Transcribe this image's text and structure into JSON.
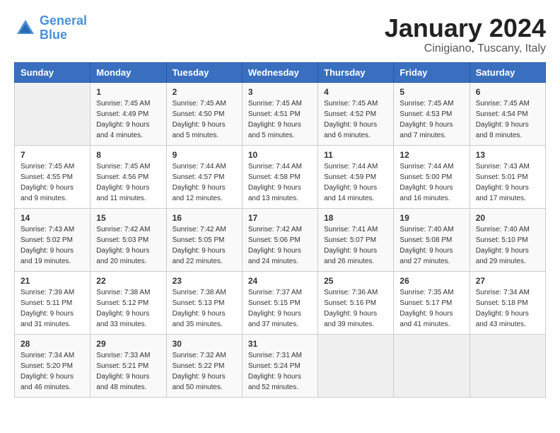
{
  "header": {
    "logo_line1": "General",
    "logo_line2": "Blue",
    "month": "January 2024",
    "location": "Cinigiano, Tuscany, Italy"
  },
  "days_of_week": [
    "Sunday",
    "Monday",
    "Tuesday",
    "Wednesday",
    "Thursday",
    "Friday",
    "Saturday"
  ],
  "weeks": [
    [
      {
        "day": "",
        "sunrise": "",
        "sunset": "",
        "daylight": ""
      },
      {
        "day": "1",
        "sunrise": "Sunrise: 7:45 AM",
        "sunset": "Sunset: 4:49 PM",
        "daylight": "Daylight: 9 hours and 4 minutes."
      },
      {
        "day": "2",
        "sunrise": "Sunrise: 7:45 AM",
        "sunset": "Sunset: 4:50 PM",
        "daylight": "Daylight: 9 hours and 5 minutes."
      },
      {
        "day": "3",
        "sunrise": "Sunrise: 7:45 AM",
        "sunset": "Sunset: 4:51 PM",
        "daylight": "Daylight: 9 hours and 5 minutes."
      },
      {
        "day": "4",
        "sunrise": "Sunrise: 7:45 AM",
        "sunset": "Sunset: 4:52 PM",
        "daylight": "Daylight: 9 hours and 6 minutes."
      },
      {
        "day": "5",
        "sunrise": "Sunrise: 7:45 AM",
        "sunset": "Sunset: 4:53 PM",
        "daylight": "Daylight: 9 hours and 7 minutes."
      },
      {
        "day": "6",
        "sunrise": "Sunrise: 7:45 AM",
        "sunset": "Sunset: 4:54 PM",
        "daylight": "Daylight: 9 hours and 8 minutes."
      }
    ],
    [
      {
        "day": "7",
        "sunrise": "Sunrise: 7:45 AM",
        "sunset": "Sunset: 4:55 PM",
        "daylight": "Daylight: 9 hours and 9 minutes."
      },
      {
        "day": "8",
        "sunrise": "Sunrise: 7:45 AM",
        "sunset": "Sunset: 4:56 PM",
        "daylight": "Daylight: 9 hours and 11 minutes."
      },
      {
        "day": "9",
        "sunrise": "Sunrise: 7:44 AM",
        "sunset": "Sunset: 4:57 PM",
        "daylight": "Daylight: 9 hours and 12 minutes."
      },
      {
        "day": "10",
        "sunrise": "Sunrise: 7:44 AM",
        "sunset": "Sunset: 4:58 PM",
        "daylight": "Daylight: 9 hours and 13 minutes."
      },
      {
        "day": "11",
        "sunrise": "Sunrise: 7:44 AM",
        "sunset": "Sunset: 4:59 PM",
        "daylight": "Daylight: 9 hours and 14 minutes."
      },
      {
        "day": "12",
        "sunrise": "Sunrise: 7:44 AM",
        "sunset": "Sunset: 5:00 PM",
        "daylight": "Daylight: 9 hours and 16 minutes."
      },
      {
        "day": "13",
        "sunrise": "Sunrise: 7:43 AM",
        "sunset": "Sunset: 5:01 PM",
        "daylight": "Daylight: 9 hours and 17 minutes."
      }
    ],
    [
      {
        "day": "14",
        "sunrise": "Sunrise: 7:43 AM",
        "sunset": "Sunset: 5:02 PM",
        "daylight": "Daylight: 9 hours and 19 minutes."
      },
      {
        "day": "15",
        "sunrise": "Sunrise: 7:42 AM",
        "sunset": "Sunset: 5:03 PM",
        "daylight": "Daylight: 9 hours and 20 minutes."
      },
      {
        "day": "16",
        "sunrise": "Sunrise: 7:42 AM",
        "sunset": "Sunset: 5:05 PM",
        "daylight": "Daylight: 9 hours and 22 minutes."
      },
      {
        "day": "17",
        "sunrise": "Sunrise: 7:42 AM",
        "sunset": "Sunset: 5:06 PM",
        "daylight": "Daylight: 9 hours and 24 minutes."
      },
      {
        "day": "18",
        "sunrise": "Sunrise: 7:41 AM",
        "sunset": "Sunset: 5:07 PM",
        "daylight": "Daylight: 9 hours and 26 minutes."
      },
      {
        "day": "19",
        "sunrise": "Sunrise: 7:40 AM",
        "sunset": "Sunset: 5:08 PM",
        "daylight": "Daylight: 9 hours and 27 minutes."
      },
      {
        "day": "20",
        "sunrise": "Sunrise: 7:40 AM",
        "sunset": "Sunset: 5:10 PM",
        "daylight": "Daylight: 9 hours and 29 minutes."
      }
    ],
    [
      {
        "day": "21",
        "sunrise": "Sunrise: 7:39 AM",
        "sunset": "Sunset: 5:11 PM",
        "daylight": "Daylight: 9 hours and 31 minutes."
      },
      {
        "day": "22",
        "sunrise": "Sunrise: 7:38 AM",
        "sunset": "Sunset: 5:12 PM",
        "daylight": "Daylight: 9 hours and 33 minutes."
      },
      {
        "day": "23",
        "sunrise": "Sunrise: 7:38 AM",
        "sunset": "Sunset: 5:13 PM",
        "daylight": "Daylight: 9 hours and 35 minutes."
      },
      {
        "day": "24",
        "sunrise": "Sunrise: 7:37 AM",
        "sunset": "Sunset: 5:15 PM",
        "daylight": "Daylight: 9 hours and 37 minutes."
      },
      {
        "day": "25",
        "sunrise": "Sunrise: 7:36 AM",
        "sunset": "Sunset: 5:16 PM",
        "daylight": "Daylight: 9 hours and 39 minutes."
      },
      {
        "day": "26",
        "sunrise": "Sunrise: 7:35 AM",
        "sunset": "Sunset: 5:17 PM",
        "daylight": "Daylight: 9 hours and 41 minutes."
      },
      {
        "day": "27",
        "sunrise": "Sunrise: 7:34 AM",
        "sunset": "Sunset: 5:18 PM",
        "daylight": "Daylight: 9 hours and 43 minutes."
      }
    ],
    [
      {
        "day": "28",
        "sunrise": "Sunrise: 7:34 AM",
        "sunset": "Sunset: 5:20 PM",
        "daylight": "Daylight: 9 hours and 46 minutes."
      },
      {
        "day": "29",
        "sunrise": "Sunrise: 7:33 AM",
        "sunset": "Sunset: 5:21 PM",
        "daylight": "Daylight: 9 hours and 48 minutes."
      },
      {
        "day": "30",
        "sunrise": "Sunrise: 7:32 AM",
        "sunset": "Sunset: 5:22 PM",
        "daylight": "Daylight: 9 hours and 50 minutes."
      },
      {
        "day": "31",
        "sunrise": "Sunrise: 7:31 AM",
        "sunset": "Sunset: 5:24 PM",
        "daylight": "Daylight: 9 hours and 52 minutes."
      },
      {
        "day": "",
        "sunrise": "",
        "sunset": "",
        "daylight": ""
      },
      {
        "day": "",
        "sunrise": "",
        "sunset": "",
        "daylight": ""
      },
      {
        "day": "",
        "sunrise": "",
        "sunset": "",
        "daylight": ""
      }
    ]
  ]
}
